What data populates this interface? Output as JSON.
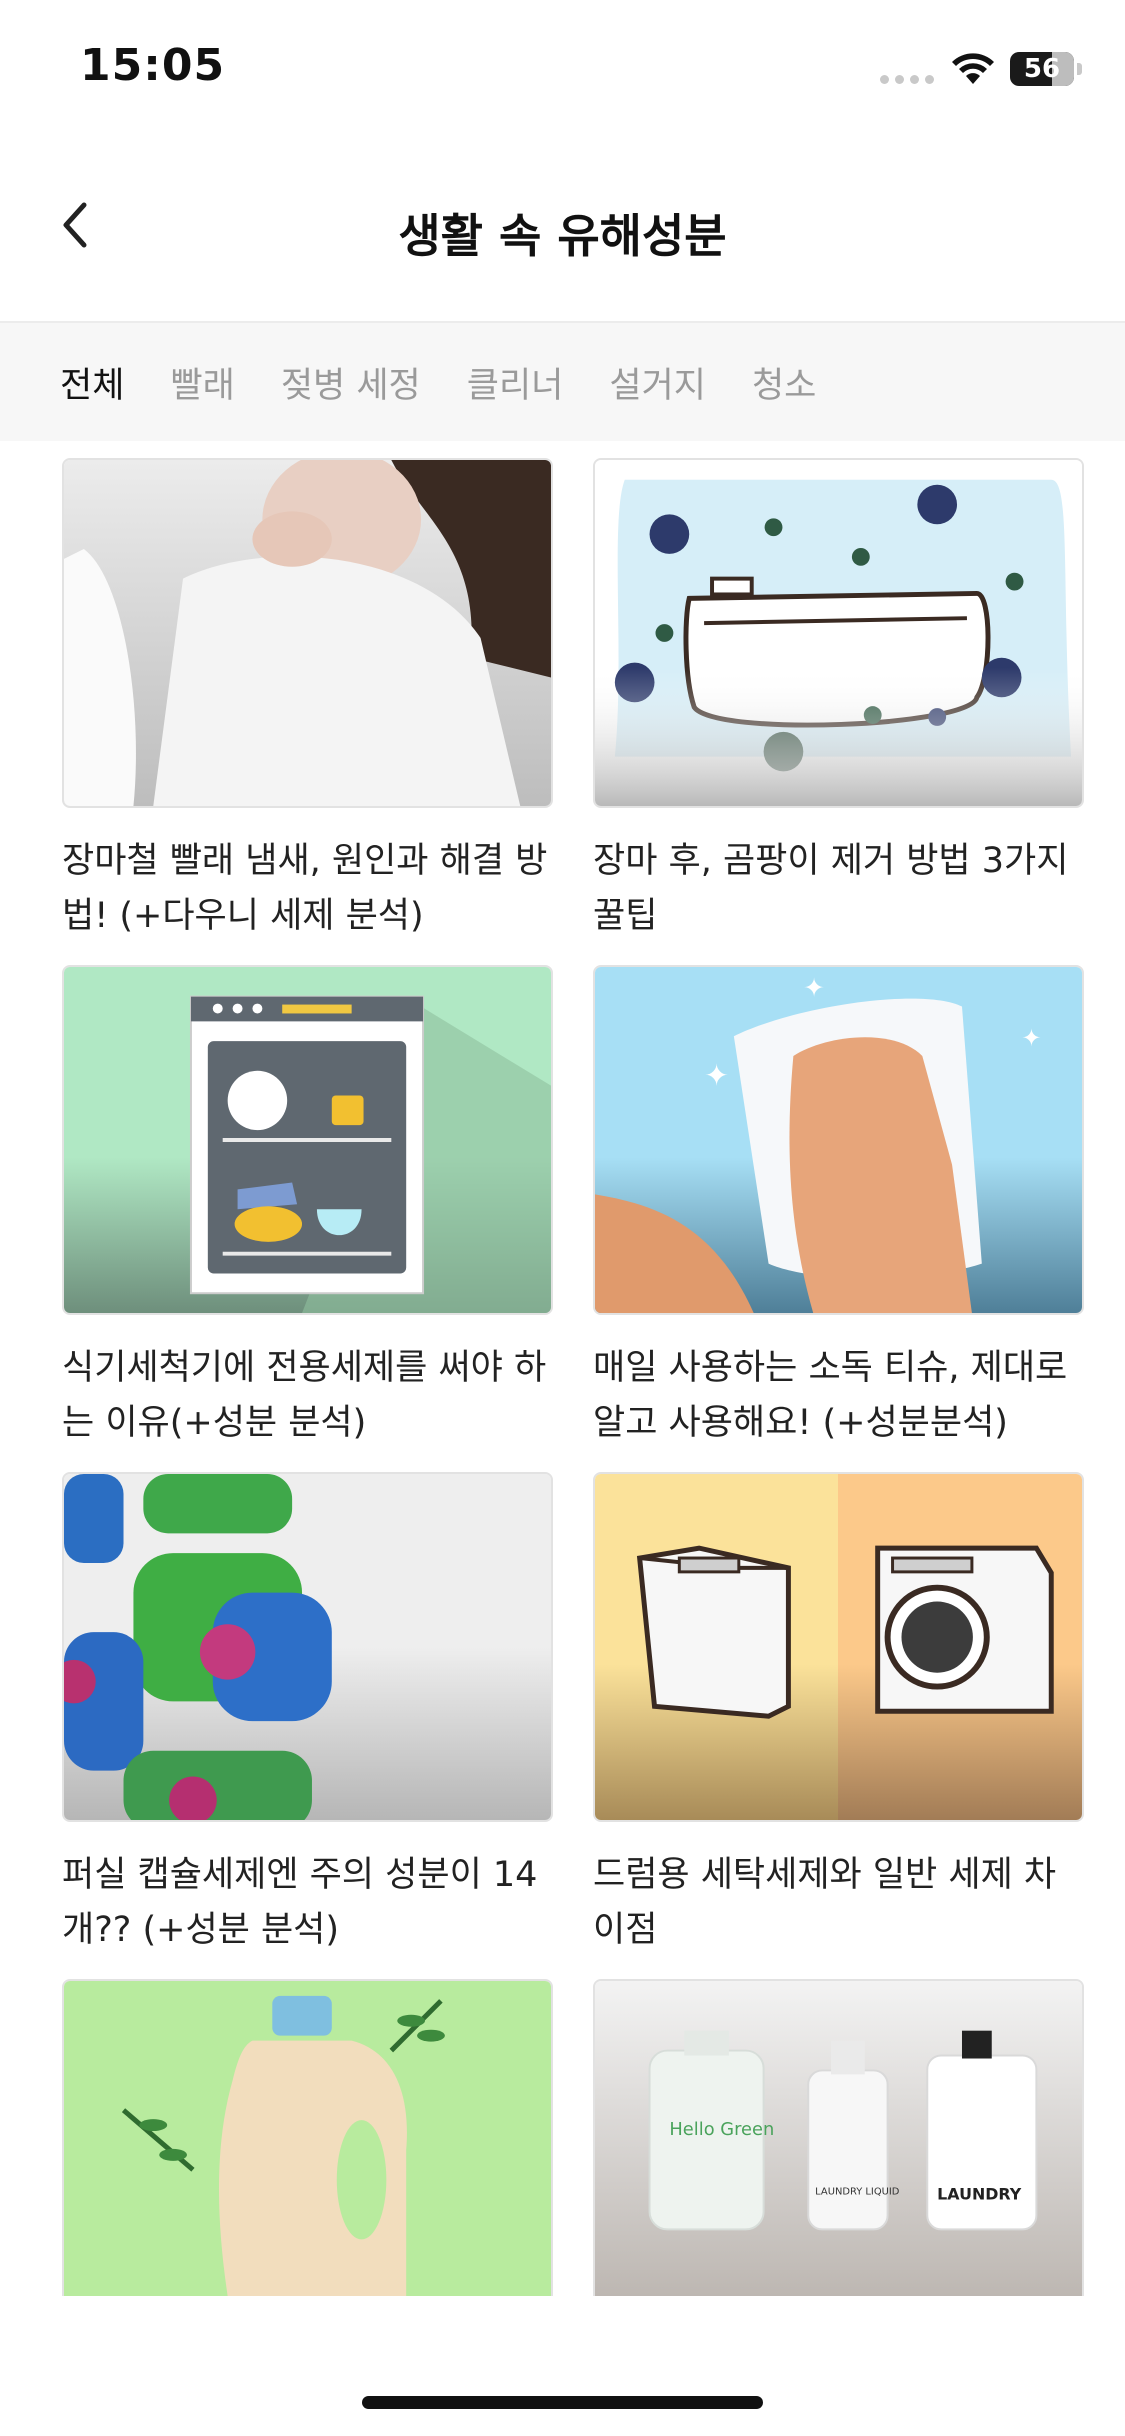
{
  "status_bar": {
    "time": "15:05",
    "battery_level": "56",
    "icons": [
      "signal-icon",
      "wifi-icon",
      "battery-icon"
    ]
  },
  "header": {
    "title": "생활 속 유해성분",
    "back_icon": "chevron-left-icon"
  },
  "tabs": [
    {
      "label": "전체",
      "active": true
    },
    {
      "label": "빨래",
      "active": false
    },
    {
      "label": "젖병 세정",
      "active": false
    },
    {
      "label": "클리너",
      "active": false
    },
    {
      "label": "설거지",
      "active": false
    },
    {
      "label": "청소",
      "active": false
    }
  ],
  "articles": [
    {
      "title": "장마철 빨래 냄새, 원인과 해결 방법! (+다우니 세제 분석)"
    },
    {
      "title": "장마 후, 곰팡이 제거 방법 3가지 꿀팁"
    },
    {
      "title": "식기세척기에 전용세제를 써야 하는 이유(+성분 분석)"
    },
    {
      "title": "매일 사용하는 소독 티슈, 제대로 알고 사용해요! (+성분분석)"
    },
    {
      "title": "퍼실 캡슐세제엔 주의 성분이 14개?? (+성분 분석)"
    },
    {
      "title": "드럼용 세탁세제와 일반 세제 차이점"
    },
    {
      "title": ""
    },
    {
      "title": ""
    }
  ],
  "image_text": {
    "bottle_1": "Hello Green",
    "bottle_2": "LAUNDRY LIQUID",
    "bottle_3": "LAUNDRY"
  },
  "colors": {
    "accent_tab": "#111111",
    "inactive_tab": "#9a9a9a",
    "tab_bar_bg": "#f7f7f7"
  }
}
